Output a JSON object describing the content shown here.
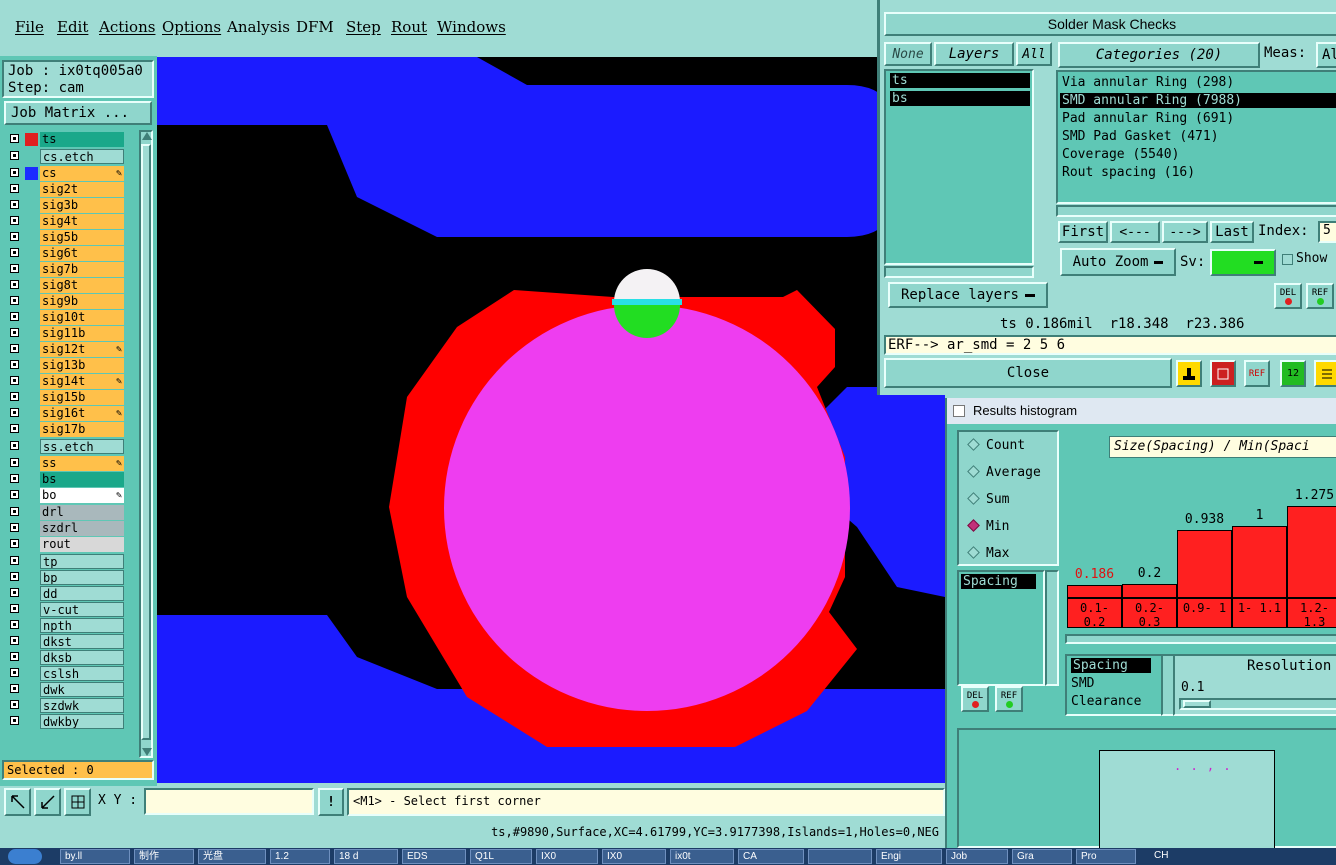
{
  "menu": {
    "items": [
      "File",
      "Edit",
      "Actions",
      "Options",
      "Analysis",
      "DFM",
      "Step",
      "Rout",
      "Windows"
    ]
  },
  "left": {
    "job": "Job : ix0tq005a0",
    "step": "Step: cam",
    "job_matrix": "Job Matrix ...",
    "selected": "Selected : 0",
    "layers": [
      {
        "name": "ts",
        "bg": "#1aa88a",
        "swatch": "#e02020",
        "sel": true
      },
      {
        "name": "cs.etch",
        "bg": "#9fdcd4"
      },
      {
        "name": "cs",
        "bg": "#ffc04a",
        "swatch": "#1b2cff",
        "mark": "✎"
      },
      {
        "name": "sig2t",
        "bg": "#ffc04a"
      },
      {
        "name": "sig3b",
        "bg": "#ffc04a"
      },
      {
        "name": "sig4t",
        "bg": "#ffc04a"
      },
      {
        "name": "sig5b",
        "bg": "#ffc04a"
      },
      {
        "name": "sig6t",
        "bg": "#ffc04a"
      },
      {
        "name": "sig7b",
        "bg": "#ffc04a"
      },
      {
        "name": "sig8t",
        "bg": "#ffc04a"
      },
      {
        "name": "sig9b",
        "bg": "#ffc04a"
      },
      {
        "name": "sig10t",
        "bg": "#ffc04a"
      },
      {
        "name": "sig11b",
        "bg": "#ffc04a"
      },
      {
        "name": "sig12t",
        "bg": "#ffc04a",
        "mark": "✎"
      },
      {
        "name": "sig13b",
        "bg": "#ffc04a"
      },
      {
        "name": "sig14t",
        "bg": "#ffc04a",
        "mark": "✎"
      },
      {
        "name": "sig15b",
        "bg": "#ffc04a"
      },
      {
        "name": "sig16t",
        "bg": "#ffc04a",
        "mark": "✎"
      },
      {
        "name": "sig17b",
        "bg": "#ffc04a"
      },
      {
        "name": "ss.etch",
        "bg": "#9fdcd4"
      },
      {
        "name": "ss",
        "bg": "#ffc04a",
        "mark": "✎"
      },
      {
        "name": "bs",
        "bg": "#1aa88a",
        "sel": true
      },
      {
        "name": "bo",
        "bg": "#ffffff",
        "mark": "✎"
      },
      {
        "name": "drl",
        "bg": "#a9b8bc"
      },
      {
        "name": "szdrl",
        "bg": "#a9b8bc"
      },
      {
        "name": "rout",
        "bg": "#d8d8d8"
      },
      {
        "name": "tp",
        "bg": "#9fdcd4"
      },
      {
        "name": "bp",
        "bg": "#9fdcd4"
      },
      {
        "name": "dd",
        "bg": "#9fdcd4"
      },
      {
        "name": "v-cut",
        "bg": "#9fdcd4"
      },
      {
        "name": "npth",
        "bg": "#9fdcd4"
      },
      {
        "name": "dkst",
        "bg": "#9fdcd4"
      },
      {
        "name": "dksb",
        "bg": "#9fdcd4"
      },
      {
        "name": "cslsh",
        "bg": "#9fdcd4"
      },
      {
        "name": "dwk",
        "bg": "#9fdcd4"
      },
      {
        "name": "szdwk",
        "bg": "#9fdcd4"
      },
      {
        "name": "dwkby",
        "bg": "#9fdcd4"
      }
    ]
  },
  "cmd": {
    "xy_label": "X Y :",
    "xy_value": "",
    "alert": "!",
    "prompt": "<M1> - Select first corner"
  },
  "status": {
    "text": "ts,#9890,Surface,XC=4.61799,YC=3.9177398,Islands=1,Holes=0,NEG"
  },
  "sm": {
    "title": "Solder Mask Checks",
    "none": "None",
    "layers_btn": "Layers",
    "all": "All",
    "layer_list": [
      "ts",
      "bs"
    ],
    "categories_btn": "Categories (20)",
    "meas": "Meas:",
    "meas_all": "Al",
    "categories": [
      {
        "label": "Via annular Ring (298)",
        "sel": false
      },
      {
        "label": "SMD annular Ring (7988)",
        "sel": true
      },
      {
        "label": "Pad annular Ring (691)",
        "sel": false
      },
      {
        "label": "SMD Pad Gasket (471)",
        "sel": false
      },
      {
        "label": "Coverage (5540)",
        "sel": false
      },
      {
        "label": "Rout spacing (16)",
        "sel": false
      }
    ],
    "first": "First",
    "prev": "<---",
    "next": "--->",
    "last": "Last",
    "index_label": "Index:",
    "index_value": "5",
    "auto_zoom": "Auto Zoom",
    "sv": "Sv:",
    "show": "Show",
    "replace": "Replace layers",
    "del": "DEL",
    "ref": "REF",
    "info": "ts 0.186mil  r18.348  r23.386",
    "erf": "ERF--> ar_smd = 2 5 6",
    "close": "Close"
  },
  "hist": {
    "title": "Results histogram",
    "modes": [
      {
        "label": "Count",
        "on": false
      },
      {
        "label": "Average",
        "on": false
      },
      {
        "label": "Sum",
        "on": false
      },
      {
        "label": "Min",
        "on": true
      },
      {
        "label": "Max",
        "on": false
      }
    ],
    "spacing_list": [
      "Spacing"
    ],
    "header": "Size(Spacing) / Min(Spaci",
    "bars": [
      {
        "value": "0.186",
        "h": 0.186,
        "range": "0.1- 0.2",
        "red": true
      },
      {
        "value": "0.2",
        "h": 0.2,
        "range": "0.2- 0.3",
        "red": false
      },
      {
        "value": "0.938",
        "h": 0.938,
        "range": "0.9- 1",
        "red": false
      },
      {
        "value": "1",
        "h": 1.0,
        "range": "1- 1.1",
        "red": false
      },
      {
        "value": "1.275",
        "h": 1.275,
        "range": "1.2- 1.3",
        "red": false
      }
    ],
    "types": [
      "Spacing",
      "SMD",
      "Clearance"
    ],
    "resolution_label": "Resolution",
    "resolution_value": "0.1",
    "del": "DEL",
    "ref": "REF",
    "dots": ". . , ."
  },
  "taskbar": {
    "items": [
      "by.ll",
      "制作",
      "光盘",
      "1.2",
      "18 d",
      "EDS",
      "Q1L",
      "IX0",
      "IX0",
      "ix0t",
      "CA",
      "",
      "Engi",
      "Job",
      "Gra",
      "Pro"
    ],
    "lang": "CH"
  },
  "colors": {
    "canvas_bg": "#000000",
    "trace": "#1b1bff",
    "mask": "#ff0000",
    "pad": "#ee3df0",
    "via_white": "#f4f2f4",
    "via_cyan": "#29e0e6",
    "via_green": "#22dd22"
  }
}
